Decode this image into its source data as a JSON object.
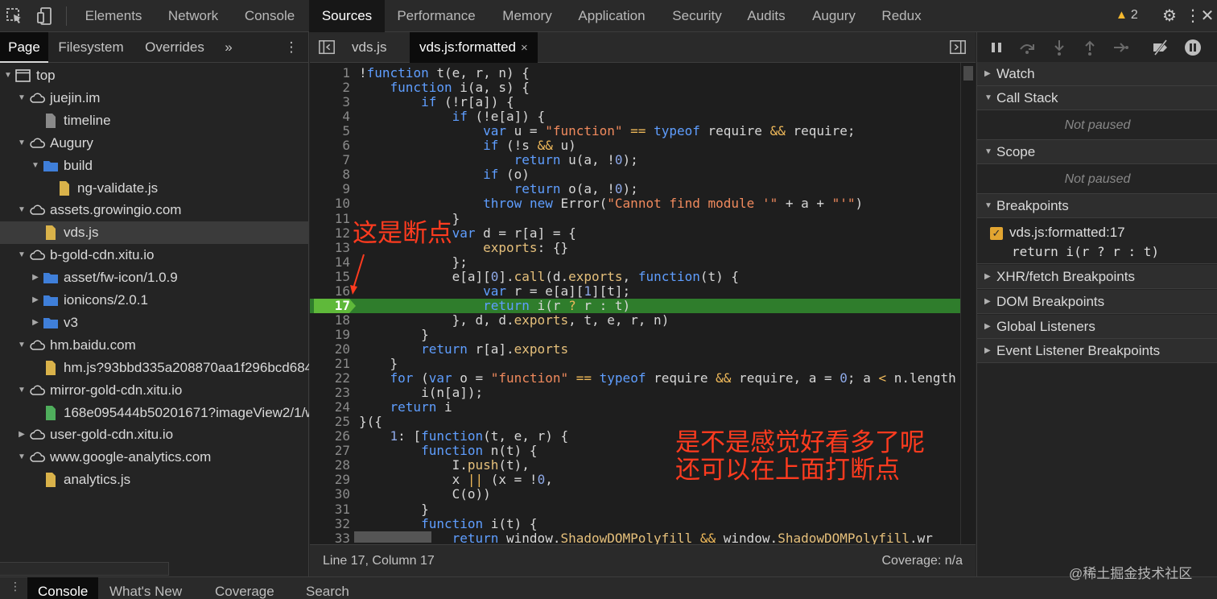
{
  "main_tabs": [
    "Elements",
    "Network",
    "Console",
    "Sources",
    "Performance",
    "Memory",
    "Application",
    "Security",
    "Audits",
    "Augury",
    "Redux"
  ],
  "active_main_tab": "Sources",
  "warnings_count": "2",
  "navigator": {
    "tabs": [
      "Page",
      "Filesystem",
      "Overrides"
    ],
    "more": "»",
    "tree": [
      {
        "label": "top",
        "type": "frame",
        "depth": 0,
        "expanded": true
      },
      {
        "label": "juejin.im",
        "type": "cloud",
        "depth": 1,
        "expanded": true
      },
      {
        "label": "timeline",
        "type": "file-gray",
        "depth": 2
      },
      {
        "label": "Augury",
        "type": "cloud",
        "depth": 1,
        "expanded": true
      },
      {
        "label": "build",
        "type": "folder",
        "depth": 2,
        "expanded": true
      },
      {
        "label": "ng-validate.js",
        "type": "file-yellow",
        "depth": 3
      },
      {
        "label": "assets.growingio.com",
        "type": "cloud",
        "depth": 1,
        "expanded": true
      },
      {
        "label": "vds.js",
        "type": "file-yellow",
        "depth": 2,
        "selected": true
      },
      {
        "label": "b-gold-cdn.xitu.io",
        "type": "cloud",
        "depth": 1,
        "expanded": true
      },
      {
        "label": "asset/fw-icon/1.0.9",
        "type": "folder",
        "depth": 2,
        "expanded": false
      },
      {
        "label": "ionicons/2.0.1",
        "type": "folder",
        "depth": 2,
        "expanded": false
      },
      {
        "label": "v3",
        "type": "folder",
        "depth": 2,
        "expanded": false
      },
      {
        "label": "hm.baidu.com",
        "type": "cloud",
        "depth": 1,
        "expanded": true
      },
      {
        "label": "hm.js?93bbd335a208870aa1f296bcd684",
        "type": "file-yellow",
        "depth": 2
      },
      {
        "label": "mirror-gold-cdn.xitu.io",
        "type": "cloud",
        "depth": 1,
        "expanded": true
      },
      {
        "label": "168e095444b50201671?imageView2/1/w",
        "type": "file-green",
        "depth": 2
      },
      {
        "label": "user-gold-cdn.xitu.io",
        "type": "cloud",
        "depth": 1,
        "expanded": false
      },
      {
        "label": "www.google-analytics.com",
        "type": "cloud",
        "depth": 1,
        "expanded": true
      },
      {
        "label": "analytics.js",
        "type": "file-yellow",
        "depth": 2
      }
    ]
  },
  "editor": {
    "tabs": [
      {
        "label": "vds.js",
        "active": false
      },
      {
        "label": "vds.js:formatted",
        "active": true,
        "close": "×"
      }
    ],
    "breakpoint_line": 17,
    "lines": [
      "!function t(e, r, n) {",
      "    function i(a, s) {",
      "        if (!r[a]) {",
      "            if (!e[a]) {",
      "                var u = \"function\" == typeof require && require;",
      "                if (!s && u)",
      "                    return u(a, !0);",
      "                if (o)",
      "                    return o(a, !0);",
      "                throw new Error(\"Cannot find module '\" + a + \"'\")",
      "            }",
      "            var d = r[a] = {",
      "                exports: {}",
      "            };",
      "            e[a][0].call(d.exports, function(t) {",
      "                var r = e[a][1][t];",
      "                return i(r ? r : t)",
      "            }, d, d.exports, t, e, r, n)",
      "        }",
      "        return r[a].exports",
      "    }",
      "    for (var o = \"function\" == typeof require && require, a = 0; a < n.length",
      "        i(n[a]);",
      "    return i",
      "}({",
      "    1: [function(t, e, r) {",
      "        function n(t) {",
      "            I.push(t),",
      "            x || (x = !0,",
      "            C(o))",
      "        }",
      "        function i(t) {",
      "            return window.ShadowDOMPolyfill && window.ShadowDOMPolyfill.wr"
    ],
    "status_position": "Line 17, Column 17",
    "status_coverage": "Coverage: n/a"
  },
  "annotations": {
    "breakpoint_note": "这是断点",
    "pretty_note_line1": "是不是感觉好看多了呢",
    "pretty_note_line2": "还可以在上面打断点",
    "color": "#ff3b1f"
  },
  "debugger": {
    "sections": {
      "watch": "Watch",
      "call_stack": "Call Stack",
      "scope": "Scope",
      "breakpoints": "Breakpoints",
      "xhr": "XHR/fetch Breakpoints",
      "dom": "DOM Breakpoints",
      "global": "Global Listeners",
      "event": "Event Listener Breakpoints"
    },
    "not_paused": "Not paused",
    "breakpoint": {
      "name": "vds.js:formatted:17",
      "code": "return i(r ? r : t)",
      "checked": true
    }
  },
  "drawer": {
    "tabs": [
      "Console",
      "What's New",
      "Coverage",
      "Search"
    ],
    "active": "Console"
  },
  "watermark": "@稀土掘金技术社区"
}
